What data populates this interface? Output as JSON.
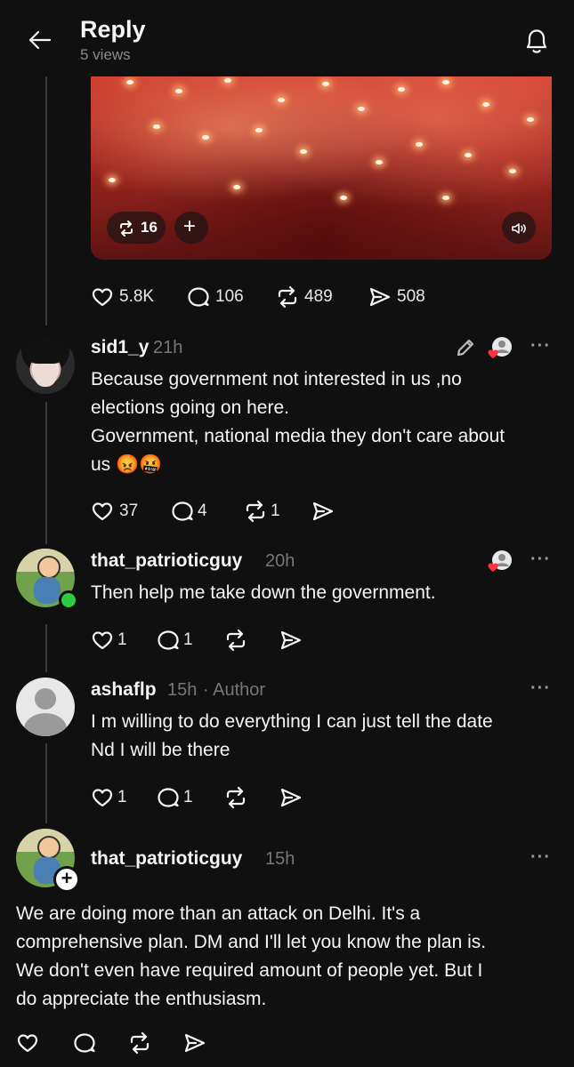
{
  "header": {
    "title": "Reply",
    "views": "5 views"
  },
  "post": {
    "reposts_overlay": "16",
    "likes": "5.8K",
    "replies": "106",
    "reposts": "489",
    "shares": "508"
  },
  "comments": [
    {
      "username": "sid1_y",
      "time": "21h",
      "lines": [
        "Because government not interested in us ,no",
        "elections going on here.",
        "Government, national media they don't care about",
        "us 😡🤬"
      ],
      "likes": "37",
      "replies": "4",
      "reposts": "1"
    },
    {
      "username": "that_patrioticguy",
      "time": "20h",
      "lines": [
        "Then help me take down the government."
      ],
      "likes": "1",
      "replies": "1"
    },
    {
      "username": "ashaflp",
      "time": "15h",
      "author_tag": "· Author",
      "lines": [
        "I m willing to do everything I can just tell the date",
        "Nd I will be there"
      ],
      "likes": "1",
      "replies": "1"
    },
    {
      "username": "that_patrioticguy",
      "time": "15h",
      "lines": [
        "We are doing more than an attack on Delhi. It's a",
        "comprehensive plan. DM and I'll let you know the plan is.",
        "We don't even have required amount of people yet. But I",
        "do appreciate the enthusiasm."
      ]
    }
  ],
  "colors": {
    "background": "#101010",
    "text": "#f3f5f7",
    "muted": "#777777",
    "heart": "#ff3040",
    "online": "#2ecc40"
  }
}
